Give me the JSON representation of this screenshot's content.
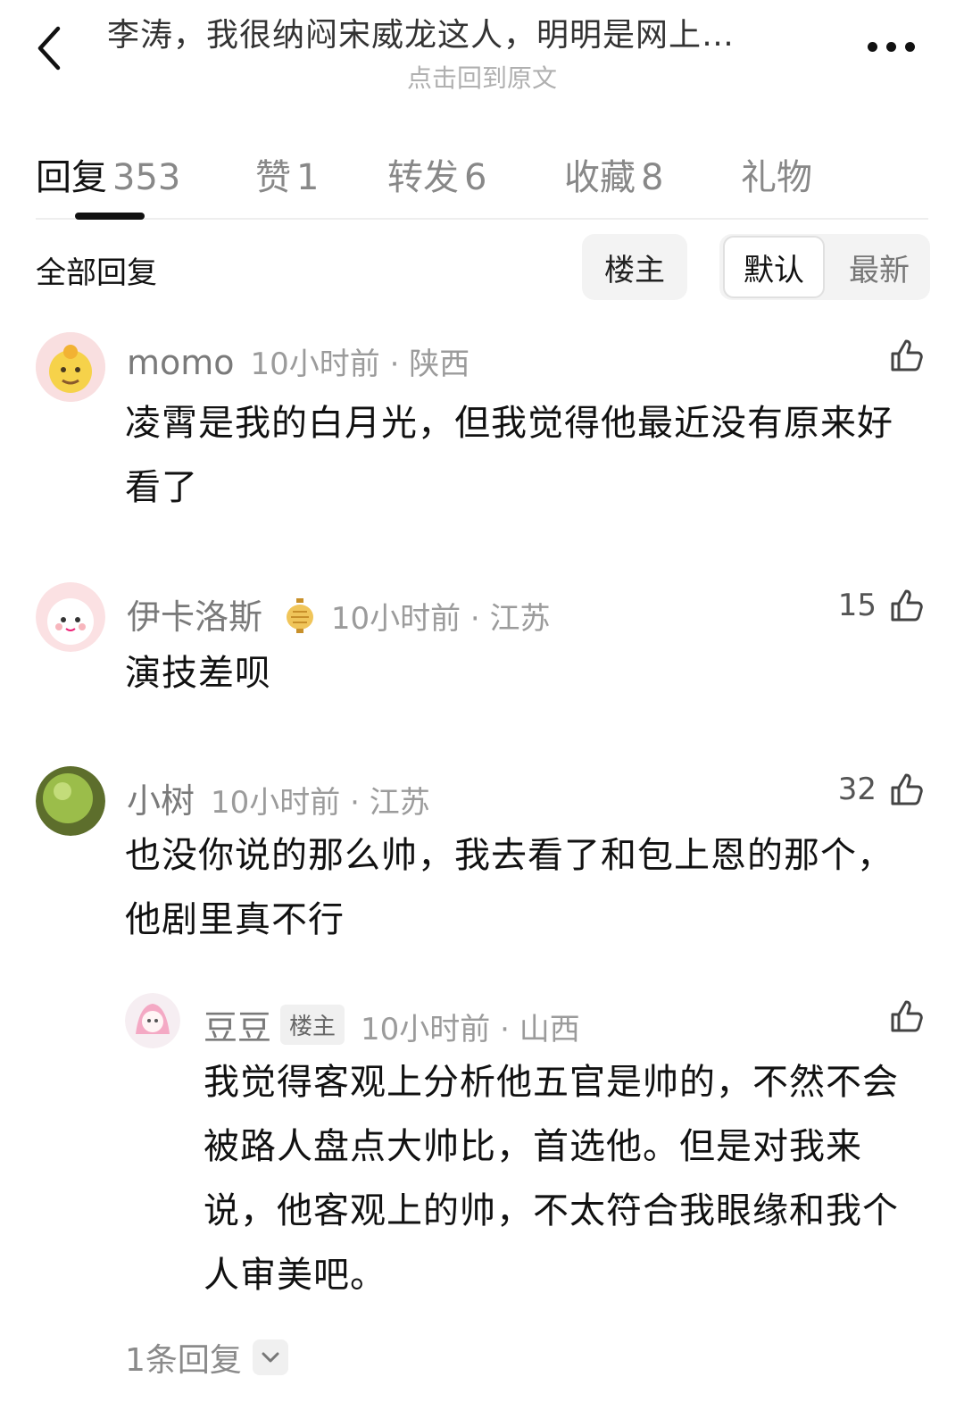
{
  "header": {
    "title": "李涛，我很纳闷宋威龙这人，明明是网上…",
    "subtitle": "点击回到原文"
  },
  "tabs": [
    {
      "label": "回复",
      "count": "353"
    },
    {
      "label": "赞",
      "count": "1"
    },
    {
      "label": "转发",
      "count": "6"
    },
    {
      "label": "收藏",
      "count": "8"
    },
    {
      "label": "礼物",
      "count": ""
    }
  ],
  "filter": {
    "all_label": "全部回复",
    "op_label": "楼主",
    "sort_default": "默认",
    "sort_latest": "最新"
  },
  "comments": [
    {
      "name": "momo",
      "meta": "10小时前 · 陕西",
      "text": "凌霄是我的白月光，但我觉得他最近没有原来好看了",
      "likes": ""
    },
    {
      "name": "伊卡洛斯",
      "meta": "10小时前 · 江苏",
      "text": "演技差呗",
      "likes": "15"
    },
    {
      "name": "小树",
      "meta": "10小时前 · 江苏",
      "text": "也没你说的那么帅，我去看了和包上恩的那个，他剧里真不行",
      "likes": "32"
    }
  ],
  "reply": {
    "name": "豆豆",
    "badge": "楼主",
    "meta": "10小时前 · 山西",
    "text": "我觉得客观上分析他五官是帅的，不然不会被路人盘点大帅比，首选他。但是对我来说，他客观上的帅，不太符合我眼缘和我个人审美吧。",
    "likes": ""
  },
  "more_replies": "1条回复",
  "colors": {
    "text_primary": "#111111",
    "text_secondary": "#8a8a8a",
    "chip_bg": "#f3f3f3"
  },
  "icons": [
    "back-arrow-icon",
    "more-dots-icon",
    "thumbs-up-icon",
    "lantern-badge-icon",
    "chevron-down-icon"
  ]
}
